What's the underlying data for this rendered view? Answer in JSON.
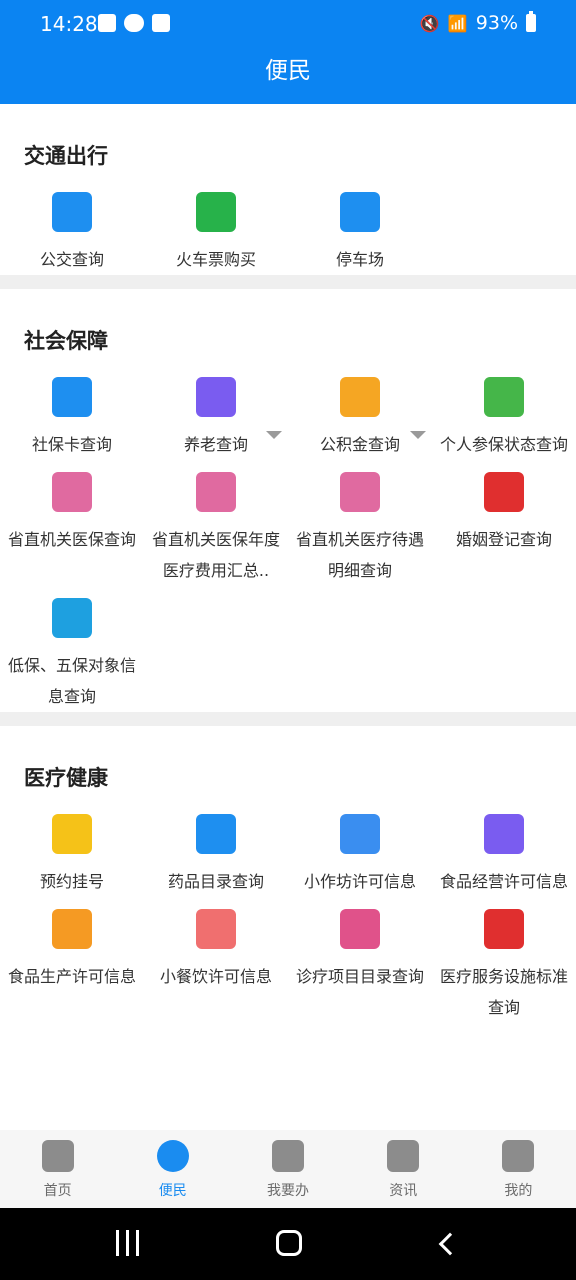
{
  "status_bar": {
    "time": "14:28",
    "battery": "93%"
  },
  "header": {
    "title": "便民"
  },
  "sections": [
    {
      "title": "交通出行",
      "items": [
        {
          "label": "公交查询",
          "icon": "bus-icon",
          "color": "#1e8ff0"
        },
        {
          "label": "火车票购买",
          "icon": "train-icon",
          "color": "#27b24a"
        },
        {
          "label": "停车场",
          "icon": "parking-icon",
          "color": "#1e8ff0"
        }
      ]
    },
    {
      "title": "社会保障",
      "items": [
        {
          "label": "社保卡查询",
          "icon": "social-security-card-icon",
          "color": "#1e8ff0"
        },
        {
          "label": "养老查询",
          "icon": "elderly-icon",
          "color": "#7a5cf0",
          "dropdown": true
        },
        {
          "label": "公积金查询",
          "icon": "housing-fund-icon",
          "color": "#f5a623",
          "dropdown": true
        },
        {
          "label": "个人参保状态查询",
          "icon": "insurance-status-icon",
          "color": "#45b649"
        },
        {
          "label": "省直机关医保查询",
          "icon": "medical-insurance-icon",
          "color": "#e06aa0"
        },
        {
          "label": "省直机关医保年度医疗费用汇总..",
          "icon": "medical-insurance-icon",
          "color": "#e06aa0"
        },
        {
          "label": "省直机关医疗待遇明细查询",
          "icon": "medical-insurance-icon",
          "color": "#e06aa0"
        },
        {
          "label": "婚姻登记查询",
          "icon": "marriage-icon",
          "color": "#e02f2f"
        },
        {
          "label": "低保、五保对象信息查询",
          "icon": "people-icon",
          "color": "#1ea0e0"
        }
      ]
    },
    {
      "title": "医疗健康",
      "items": [
        {
          "label": "预约挂号",
          "icon": "calendar-icon",
          "color": "#f5c218"
        },
        {
          "label": "药品目录查询",
          "icon": "medicine-icon",
          "color": "#1e8ff0"
        },
        {
          "label": "小作坊许可信息",
          "icon": "workshop-icon",
          "color": "#3a8ef0"
        },
        {
          "label": "食品经营许可信息",
          "icon": "license-icon",
          "color": "#7a5cf0"
        },
        {
          "label": "食品生产许可信息",
          "icon": "food-production-icon",
          "color": "#f59a23"
        },
        {
          "label": "小餐饮许可信息",
          "icon": "catering-icon",
          "color": "#f06f6f"
        },
        {
          "label": "诊疗项目目录查询",
          "icon": "clinic-icon",
          "color": "#e0528a"
        },
        {
          "label": "医疗服务设施标准查询",
          "icon": "first-aid-kit-icon",
          "color": "#e02f2f"
        }
      ]
    }
  ],
  "tabs": [
    {
      "label": "首页",
      "icon": "home-icon",
      "active": false
    },
    {
      "label": "便民",
      "icon": "clover-icon",
      "active": true
    },
    {
      "label": "我要办",
      "icon": "user-service-icon",
      "active": false
    },
    {
      "label": "资讯",
      "icon": "message-icon",
      "active": false
    },
    {
      "label": "我的",
      "icon": "profile-icon",
      "active": false
    }
  ]
}
